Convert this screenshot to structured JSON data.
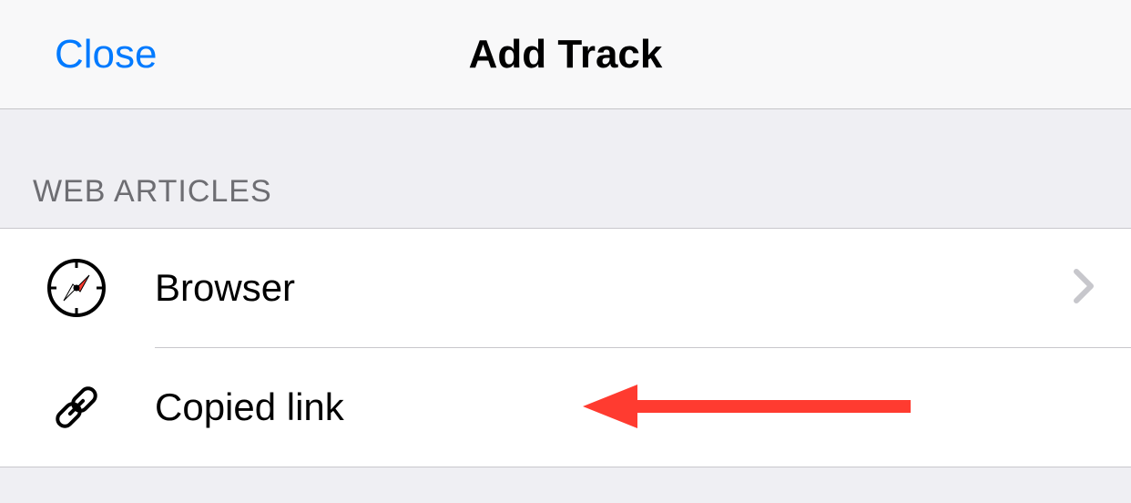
{
  "navbar": {
    "close_label": "Close",
    "title": "Add Track"
  },
  "section": {
    "header": "WEB ARTICLES",
    "rows": [
      {
        "icon": "compass-icon",
        "label": "Browser",
        "has_chevron": true
      },
      {
        "icon": "link-icon",
        "label": "Copied link",
        "has_chevron": false
      }
    ]
  },
  "annotation": {
    "type": "arrow-left",
    "color": "#ff3b30"
  }
}
